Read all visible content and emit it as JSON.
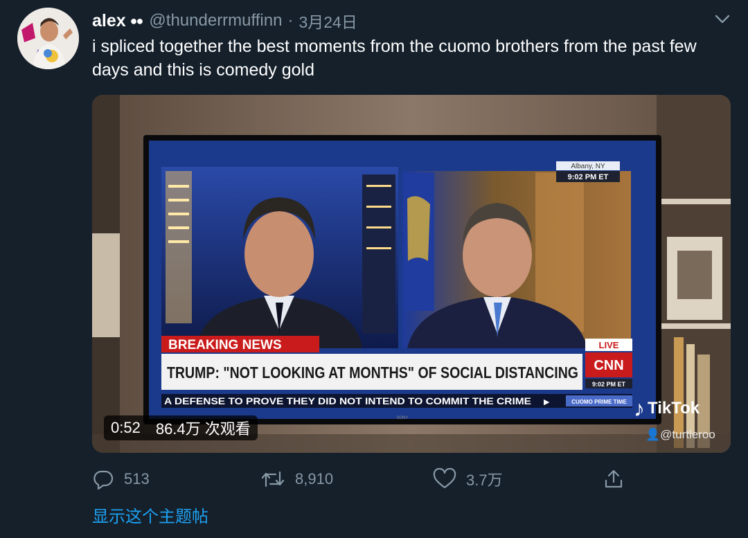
{
  "tweet": {
    "name": "alex",
    "verified_dots": "●●",
    "handle": "@thunderrmuffinn",
    "separator": "·",
    "date": "3月24日",
    "text": "i spliced together the best moments from the cuomo brothers from the past few days and this is comedy gold"
  },
  "media": {
    "duration": "0:52",
    "views": "86.4万 次观看",
    "tv": {
      "location": "Albany, NY",
      "time": "9:02 PM ET",
      "breaking_label": "BREAKING NEWS",
      "headline": "TRUMP: \"NOT LOOKING AT MONTHS\" OF SOCIAL DISTANCING",
      "live_label": "LIVE",
      "network": "CNN",
      "network_time": "9:02 PM ET",
      "ticker": "A DEFENSE TO PROVE THEY DID NOT INTEND TO COMMIT THE CRIME",
      "show_tag": "CUOMO PRIME TIME",
      "tv_brand": "SONY"
    },
    "watermark_app": "TikTok",
    "watermark_user": "@turtleroo"
  },
  "actions": {
    "replies": "513",
    "retweets": "8,910",
    "likes": "3.7万"
  },
  "thread_link": "显示这个主题帖",
  "colors": {
    "background": "#15202b",
    "muted": "#8899a6",
    "link": "#1da1f2",
    "breaking_red": "#c91b1b"
  }
}
